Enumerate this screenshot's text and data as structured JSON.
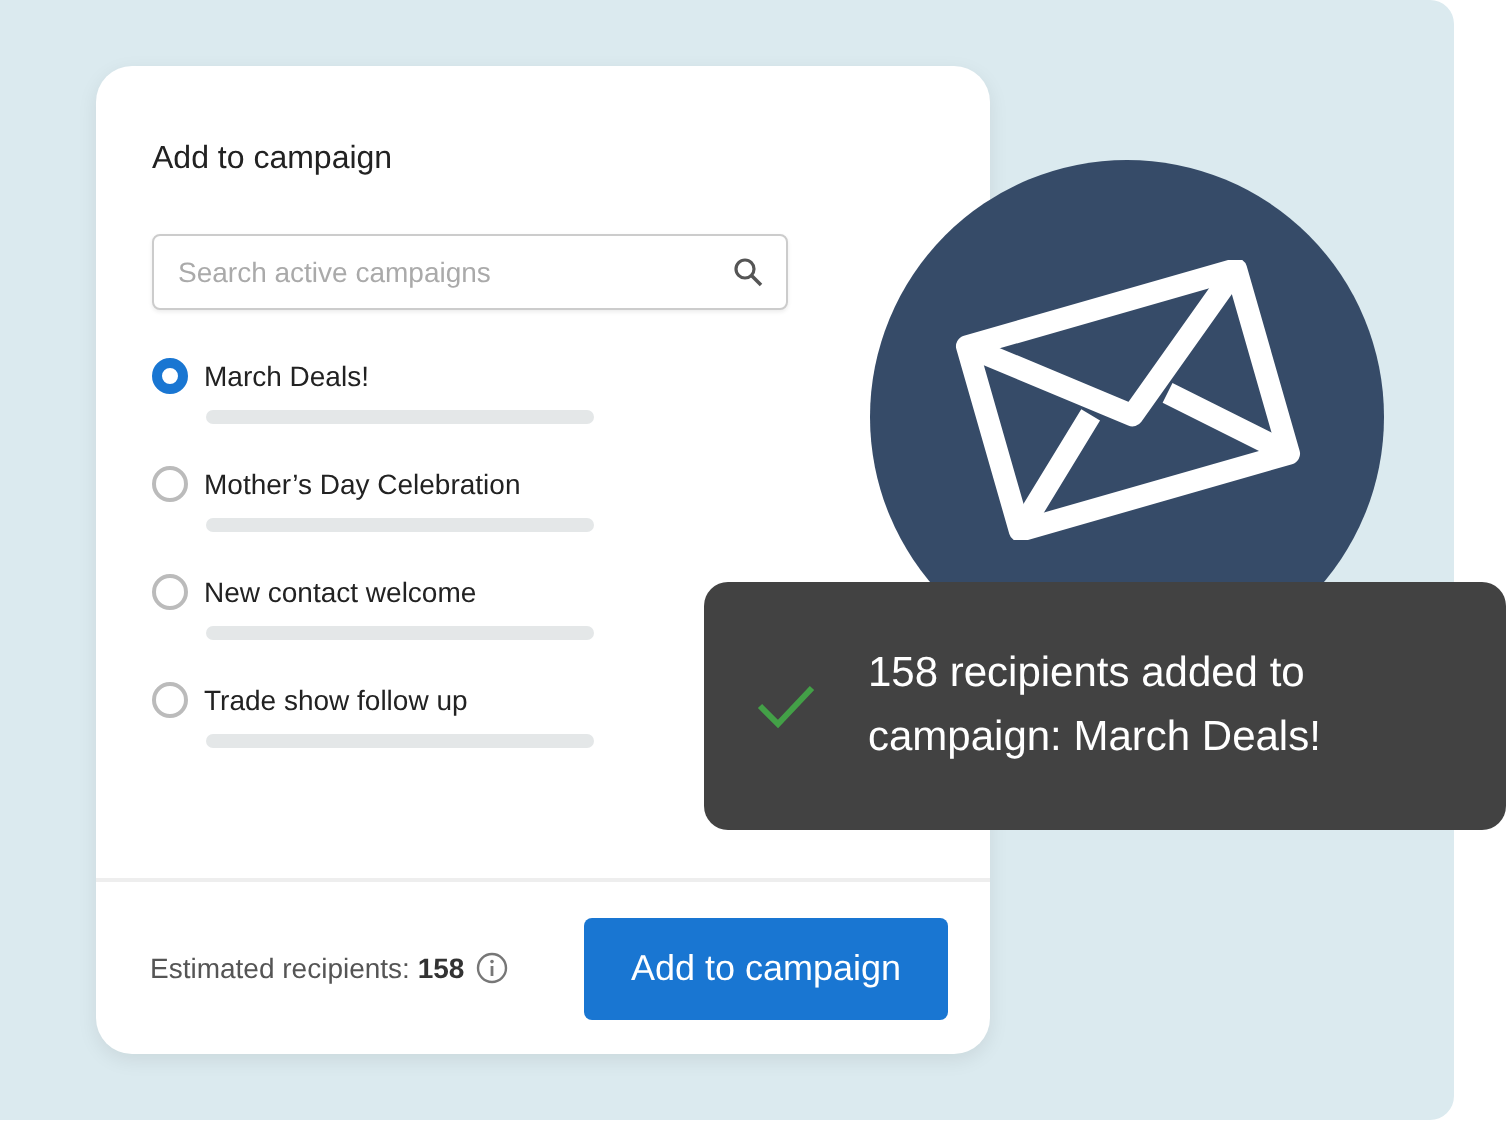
{
  "dialog": {
    "title": "Add to campaign",
    "search": {
      "placeholder": "Search active campaigns"
    },
    "campaigns": [
      {
        "label": "March Deals!",
        "selected": true
      },
      {
        "label": "Mother’s Day Celebration",
        "selected": false
      },
      {
        "label": "New contact welcome",
        "selected": false
      },
      {
        "label": "Trade show follow up",
        "selected": false
      }
    ],
    "estimate": "Estimated recipients: **158**",
    "button": "Add to campaign"
  },
  "toast": {
    "message": "158 recipients added to campaign: March Deals!"
  }
}
